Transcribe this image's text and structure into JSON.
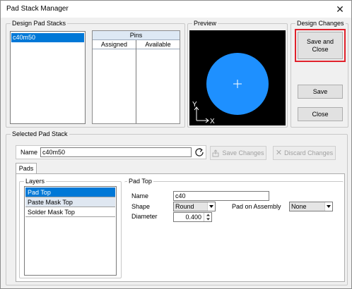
{
  "window": {
    "title": "Pad Stack Manager",
    "close_glyph": "✕"
  },
  "design_pad_stacks": {
    "legend": "Design Pad Stacks",
    "items": [
      "c40m50"
    ],
    "pins": {
      "header": "Pins",
      "columns": [
        "Assigned",
        "Available"
      ]
    }
  },
  "preview": {
    "legend": "Preview",
    "axis_y": "Y",
    "axis_x": "X",
    "pad_color": "#1e90ff"
  },
  "design_changes": {
    "legend": "Design Changes",
    "save_and_close": [
      "Save and",
      "Close"
    ],
    "save": "Save",
    "close": "Close"
  },
  "selected_pad_stack": {
    "legend": "Selected Pad Stack",
    "name_label": "Name",
    "name_value": "c40m50",
    "save_changes": "Save Changes",
    "discard_changes": "Discard Changes",
    "tab_pads": "Pads",
    "layers": {
      "legend": "Layers",
      "items": [
        "Pad Top",
        "Paste Mask Top",
        "Solder Mask Top"
      ]
    },
    "pad_top": {
      "legend": "Pad Top",
      "name_label": "Name",
      "name_value": "c40",
      "shape_label": "Shape",
      "shape_value": "Round",
      "pad_on_assembly_label": "Pad on Assembly",
      "pad_on_assembly_value": "None",
      "diameter_label": "Diameter",
      "diameter_value": "0.400"
    }
  }
}
